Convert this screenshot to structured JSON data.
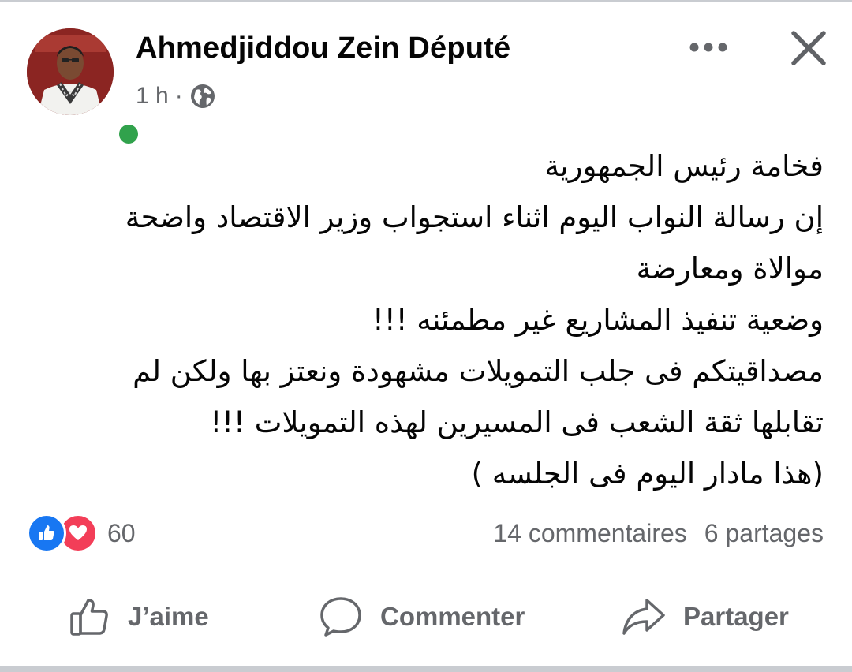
{
  "post": {
    "author": "Ahmedjiddou Zein Député",
    "time": "1 h",
    "separator": "·",
    "privacy_icon": "globe-icon",
    "lines": [
      "فخامة رئيس الجمهورية",
      "إن رسالة النواب اليوم اثناء استجواب وزير الاقتصاد  واضحة",
      "موالاة ومعارضة",
      "وضعية تنفيذ المشاريع غير مطمئنه !!!",
      "مصداقيتكم فى جلب التمويلات مشهودة ونعتز بها ولكن لم",
      "تقابلها  ثقة الشعب فى المسيرين لهذه التمويلات !!!",
      "(هذا مادار اليوم فى الجلسه )"
    ]
  },
  "reactions": {
    "icons": [
      "like-icon",
      "love-icon"
    ],
    "count": "60"
  },
  "stats": {
    "comments": "14 commentaires",
    "shares": "6 partages"
  },
  "actions": {
    "like": "J’aime",
    "comment": "Commenter",
    "share": "Partager"
  },
  "colors": {
    "online": "#31a24c",
    "like_blue": "#1877f2",
    "love_red": "#f33e58",
    "secondary_text": "#65676b"
  }
}
